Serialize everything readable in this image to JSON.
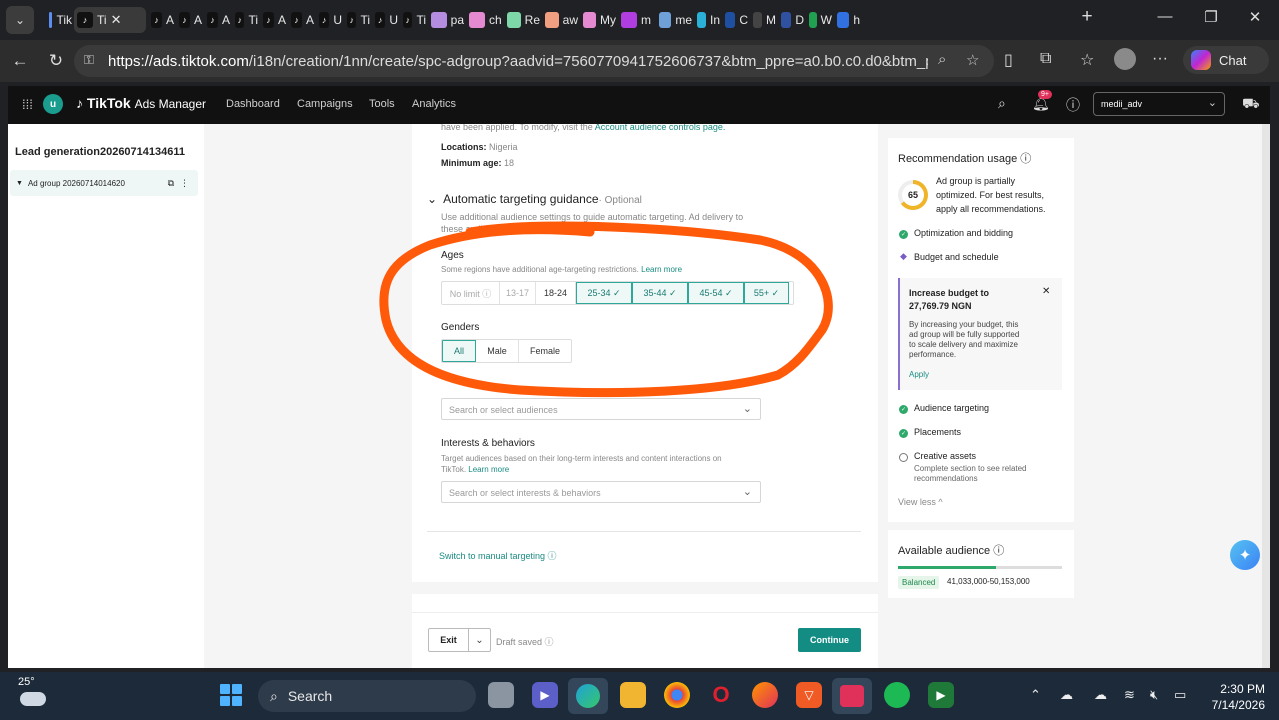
{
  "browser": {
    "tabs": [
      {
        "label": "Tik",
        "color": "#5b8ef0",
        "active": false
      },
      {
        "label": "Ti",
        "color": "#111111",
        "active": true
      },
      {
        "label": "A",
        "color": "#111111"
      },
      {
        "label": "A",
        "color": "#111111"
      },
      {
        "label": "A",
        "color": "#111111"
      },
      {
        "label": "Ti",
        "color": "#111111"
      },
      {
        "label": "A",
        "color": "#111111"
      },
      {
        "label": "A",
        "color": "#111111"
      },
      {
        "label": "U",
        "color": "#111111"
      },
      {
        "label": "Ti",
        "color": "#111111"
      },
      {
        "label": "U",
        "color": "#111111"
      },
      {
        "label": "Ti",
        "color": "#111111"
      },
      {
        "label": "pa",
        "color": "#b58de0"
      },
      {
        "label": "ch",
        "color": "#e58ad0"
      },
      {
        "label": "Re",
        "color": "#7ed7a8"
      },
      {
        "label": "aw",
        "color": "#f0a080"
      },
      {
        "label": "My",
        "color": "#e58ad0"
      },
      {
        "label": "m",
        "color": "#b03de0"
      },
      {
        "label": "me",
        "color": "#6fa0d8"
      },
      {
        "label": "In",
        "color": "#2bb0d8"
      },
      {
        "label": "C",
        "color": "#1f4fa0"
      },
      {
        "label": "M",
        "color": "#444444"
      },
      {
        "label": "D",
        "color": "#3050a0"
      },
      {
        "label": "W",
        "color": "#20a050"
      },
      {
        "label": "h",
        "color": "#3070e0"
      }
    ],
    "tab_close": "✕",
    "new_tab": "+",
    "url_host": "https://ads.tiktok.com",
    "url_path": "/i18n/creation/1nn/create/spc-adgroup?aadvid=7560770941752606737&btm_ppre=a0.b0.c0.d0&btm_pre=a...",
    "chat_label": "Chat"
  },
  "header": {
    "avatar_letter": "u",
    "brand": "TikTok",
    "brand_sub": "Ads Manager",
    "nav": [
      "Dashboard",
      "Campaigns",
      "Tools",
      "Analytics"
    ],
    "notif_badge": "9+",
    "account": "medii_adv"
  },
  "left": {
    "campaign": "Lead generation20260714134611",
    "adgroup": "Ad group 20260714014620"
  },
  "main": {
    "top_note": "have been applied. To modify, visit the",
    "top_note_link": "Account audience controls page.",
    "locations_label": "Locations:",
    "locations_value": "Nigeria",
    "min_age_label": "Minimum age:",
    "min_age_value": "18",
    "section_title": "Automatic targeting guidance",
    "section_optional": "· Optional",
    "section_desc_1": "Use additional audience settings to guide automatic targeting. Ad delivery to",
    "section_desc_2": "these audiences isn't guaranteed.",
    "ages_label": "Ages",
    "ages_note": "Some regions have additional age-targeting restrictions.",
    "learn_more": "Learn more",
    "age_options": [
      {
        "label": "No limit ⓘ",
        "state": "dim"
      },
      {
        "label": "13-17",
        "state": "dim"
      },
      {
        "label": "18-24",
        "state": "normal"
      },
      {
        "label": "25-34 ✓",
        "state": "sel"
      },
      {
        "label": "35-44 ✓",
        "state": "sel"
      },
      {
        "label": "45-54 ✓",
        "state": "sel"
      },
      {
        "label": "55+ ✓",
        "state": "sel"
      }
    ],
    "genders_label": "Genders",
    "gender_options": [
      {
        "label": "All",
        "state": "sel"
      },
      {
        "label": "Male",
        "state": "normal"
      },
      {
        "label": "Female",
        "state": "normal"
      }
    ],
    "audience_placeholder": "Search or select audiences",
    "interests_label": "Interests & behaviors",
    "interests_desc_1": "Target audiences based on their long-term interests and content interactions on",
    "interests_desc_2": "TikTok.",
    "interests_placeholder": "Search or select interests & behaviors",
    "manual_link": "Switch to manual targeting ⓘ"
  },
  "footer": {
    "exit": "Exit",
    "draft": "Draft saved ⓘ",
    "continue": "Continue"
  },
  "recommendation": {
    "title": "Recommendation usage ⓘ",
    "score": "65",
    "score_fraction": 0.65,
    "score_text_1": "Ad group is partially",
    "score_text_2": "optimized. For best results,",
    "score_text_3": "apply all recommendations.",
    "items_top": [
      "Optimization and bidding",
      "Budget and schedule"
    ],
    "budget_title_1": "Increase budget to",
    "budget_title_2": "27,769.79 NGN",
    "budget_desc": [
      "By increasing your budget, this",
      "ad group will be fully supported",
      "to scale delivery and maximize",
      "performance."
    ],
    "apply": "Apply",
    "items_bottom": [
      "Audience targeting",
      "Placements"
    ],
    "creative": "Creative assets",
    "creative_desc_1": "Complete section to see related",
    "creative_desc_2": "recommendations",
    "view_less": "View less ^"
  },
  "audience": {
    "title": "Available audience ⓘ",
    "status": "Balanced",
    "range": "41,033,000-50,153,000",
    "meter_fraction": 0.6
  },
  "taskbar": {
    "temp": "25°",
    "search": "Search",
    "time": "2:30 PM",
    "date": "7/14/2026"
  }
}
